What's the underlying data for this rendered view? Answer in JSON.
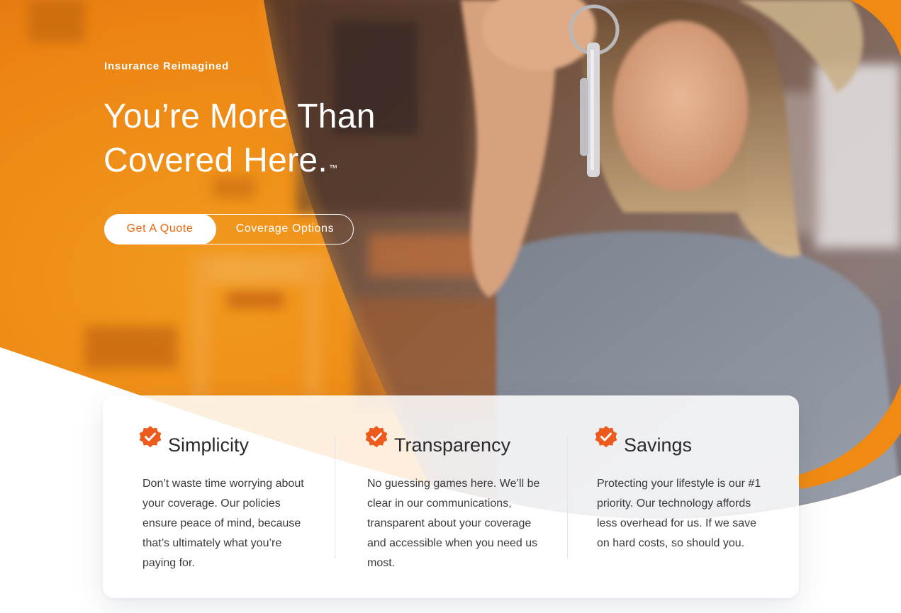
{
  "hero": {
    "eyebrow": "Insurance Reimagined",
    "headline_line1": "You’re More Than",
    "headline_line2": "Covered Here.",
    "trademark": "™",
    "primary_cta": "Get A Quote",
    "secondary_cta": "Coverage Options"
  },
  "features": [
    {
      "icon": "check-badge-icon",
      "title": "Simplicity",
      "text": "Don’t waste time worrying about your coverage. Our policies ensure peace of mind, because that’s ultimately what you’re paying for."
    },
    {
      "icon": "check-badge-icon",
      "title": "Transparency",
      "text": "No guessing games here. We’ll be clear in our communications, transparent about your coverage and accessible when you need us  most."
    },
    {
      "icon": "check-badge-icon",
      "title": "Savings",
      "text": "Protecting your lifestyle is our #1 priority. Our technology affords less overhead for us. If we save on hard costs, so should you."
    }
  ],
  "colors": {
    "brand_orange": "#e8670e",
    "badge_orange": "#ec5a1c",
    "text_dark": "#2a2a2e"
  }
}
